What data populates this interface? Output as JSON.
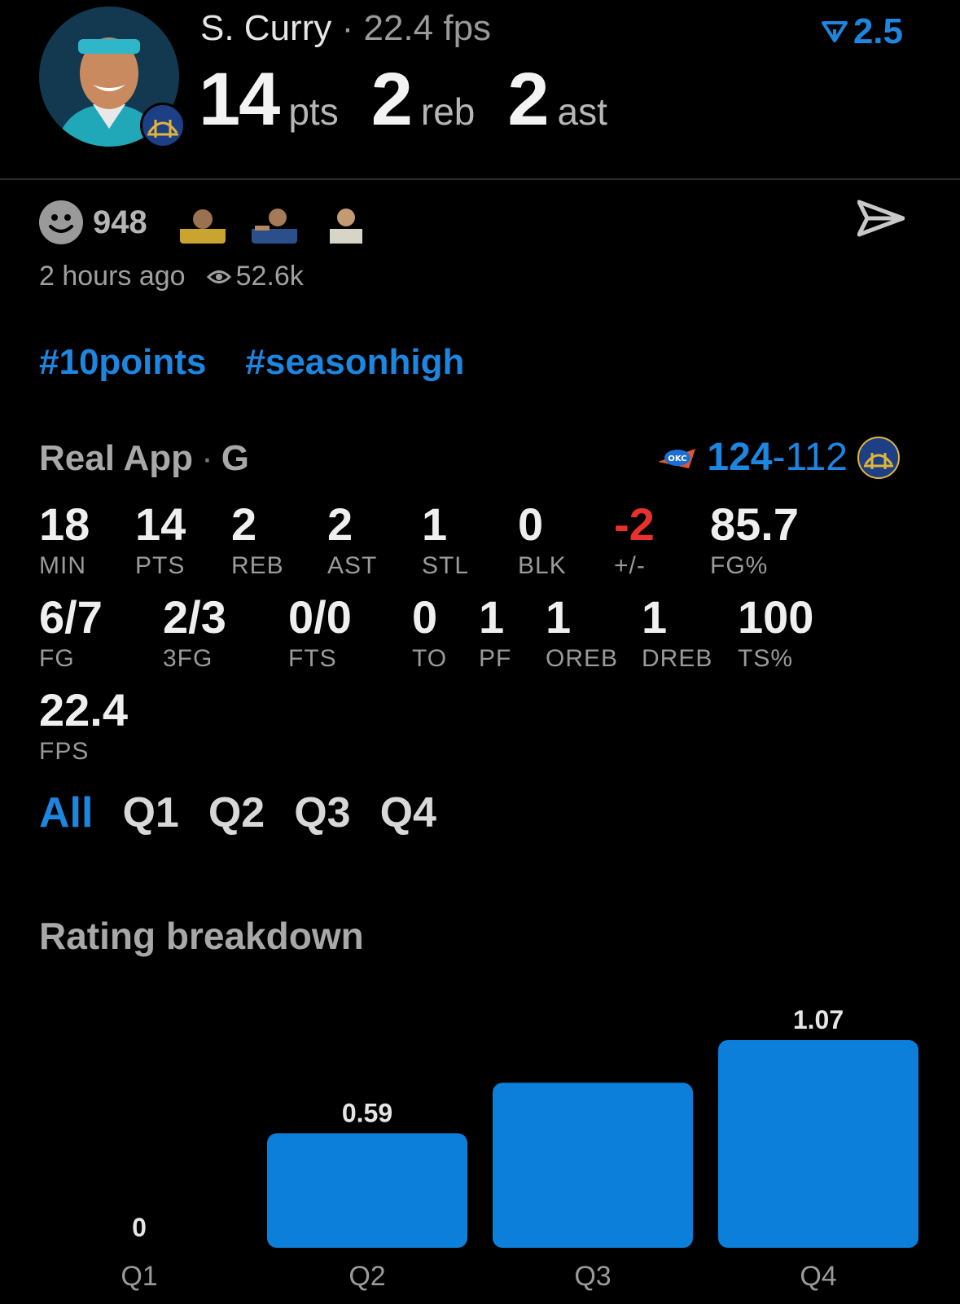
{
  "header": {
    "player_name": "S. Curry",
    "separator": "·",
    "fps_label": "22.4 fps",
    "pts_value": "14",
    "pts_unit": "pts",
    "reb_value": "2",
    "reb_unit": "reb",
    "ast_value": "2",
    "ast_unit": "ast",
    "rating_value": "2.5",
    "accent_color": "#1d86e0"
  },
  "social": {
    "reaction_count": "948",
    "time_ago": "2 hours ago",
    "views": "52.6k",
    "icons": [
      "smile-icon",
      "eye-icon",
      "send-icon"
    ]
  },
  "hashtags": [
    "#10points",
    "#seasonhigh"
  ],
  "game": {
    "source": "Real App",
    "position": "G",
    "score_winner": "124",
    "score_dash": "-",
    "score_loser": "112"
  },
  "stats_row1": [
    {
      "value": "18",
      "label": "MIN"
    },
    {
      "value": "14",
      "label": "PTS"
    },
    {
      "value": "2",
      "label": "REB"
    },
    {
      "value": "2",
      "label": "AST"
    },
    {
      "value": "1",
      "label": "STL"
    },
    {
      "value": "0",
      "label": "BLK"
    },
    {
      "value": "-2",
      "label": "+/-"
    },
    {
      "value": "85.7",
      "label": "FG%"
    }
  ],
  "stats_row2": [
    {
      "value": "6/7",
      "label": "FG"
    },
    {
      "value": "2/3",
      "label": "3FG"
    },
    {
      "value": "0/0",
      "label": "FTS"
    },
    {
      "value": "0",
      "label": "TO"
    },
    {
      "value": "1",
      "label": "PF"
    },
    {
      "value": "1",
      "label": "OREB"
    },
    {
      "value": "1",
      "label": "DREB"
    },
    {
      "value": "100",
      "label": "TS%"
    }
  ],
  "stats_row3": [
    {
      "value": "22.4",
      "label": "FPS"
    }
  ],
  "tabs": [
    "All",
    "Q1",
    "Q2",
    "Q3",
    "Q4"
  ],
  "active_tab": "All",
  "rating_section_title": "Rating breakdown",
  "chart_data": {
    "type": "bar",
    "categories": [
      "Q1",
      "Q2",
      "Q3",
      "Q4"
    ],
    "values": [
      0,
      0.59,
      0.85,
      1.07
    ],
    "value_labels": [
      "0",
      "0.59",
      "",
      "1.07"
    ],
    "title": "",
    "xlabel": "",
    "ylabel": "",
    "ylim": [
      0,
      1.07
    ],
    "bar_color": "#0b7fd9",
    "grid": false
  }
}
